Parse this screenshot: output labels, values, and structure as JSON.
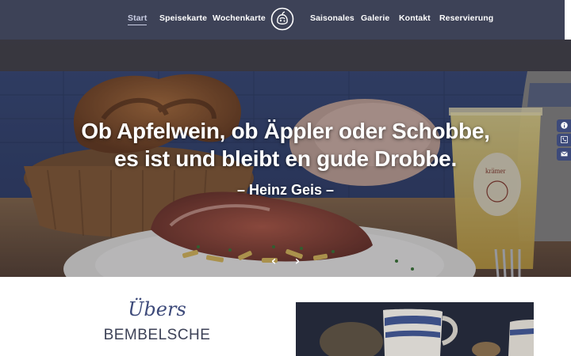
{
  "nav": {
    "items": [
      {
        "label": "Start"
      },
      {
        "label": "Speisekarte"
      },
      {
        "label": "Wochenkarte"
      },
      {
        "label": "Saisonales"
      },
      {
        "label": "Galerie"
      },
      {
        "label": "Kontakt"
      },
      {
        "label": "Reservierung"
      }
    ],
    "active_item": "Start",
    "logo_icon": "apple-jug-logo-icon"
  },
  "hero": {
    "quote_line1": "Ob Apfelwein, ob Äppler oder Schobbe,",
    "quote_line2": "es ist und bleibt en gude Drobbe.",
    "author": "– Heinz Geis –",
    "prev_icon": "chevron-left-icon",
    "next_icon": "chevron-right-icon",
    "mug_label": "krämer"
  },
  "side_buttons": [
    {
      "icon": "info-icon"
    },
    {
      "icon": "phone-icon"
    },
    {
      "icon": "envelope-icon"
    }
  ],
  "section": {
    "title_script": "Übers",
    "title_sub": "BEMBELSCHE"
  },
  "colors": {
    "navbar": "#3d4257",
    "accent": "#3d4a7a"
  }
}
